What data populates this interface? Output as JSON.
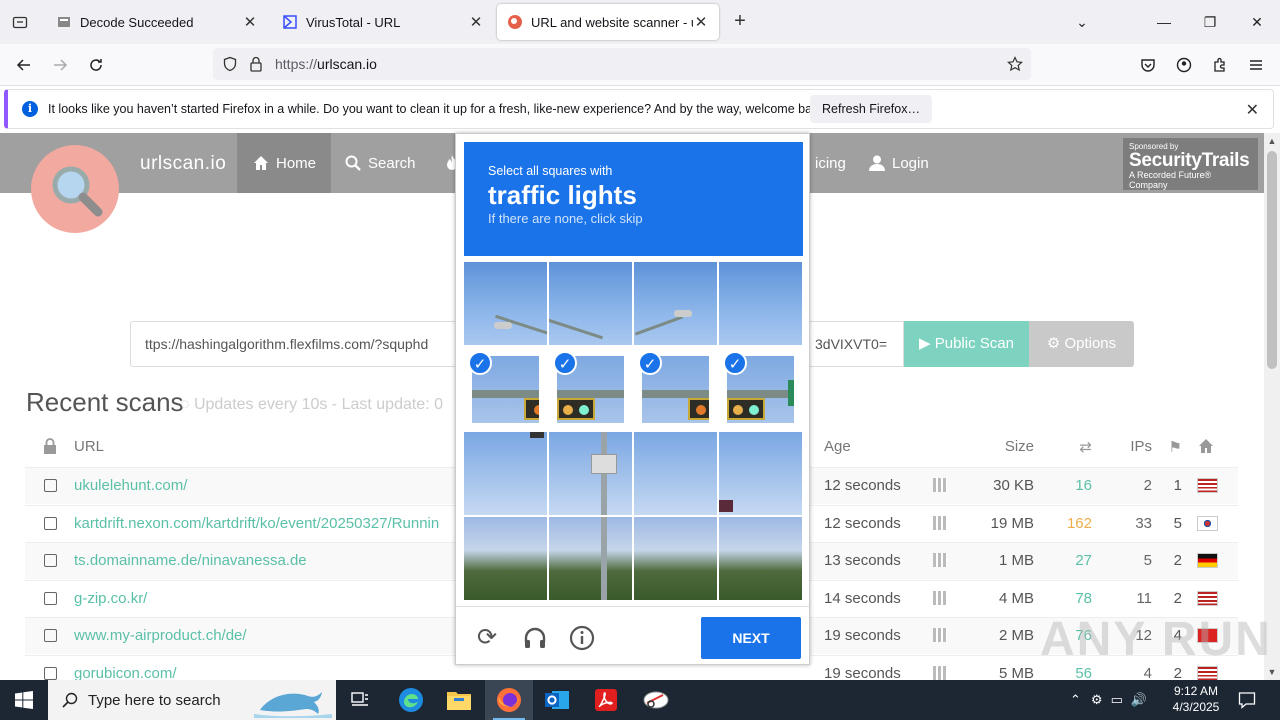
{
  "browser": {
    "tabs": [
      {
        "title": "Decode Succeeded",
        "active": false
      },
      {
        "title": "VirusTotal - URL",
        "active": false
      },
      {
        "title": "URL and website scanner - urlsca",
        "active": true
      }
    ],
    "url_prefix": "https://",
    "url_host": "urlscan.io",
    "notification": {
      "message": "It looks like you haven’t started Firefox in a while. Do you want to clean it up for a fresh, like-new experience? And by the way, welcome back!",
      "button": "Refresh Firefox…"
    }
  },
  "site": {
    "brand": "urlscan.io",
    "nav": [
      {
        "label": "Home",
        "icon": "home-icon"
      },
      {
        "label": "Search",
        "icon": "search-icon"
      },
      {
        "label": "icing",
        "icon": ""
      },
      {
        "label": "Login",
        "icon": "user-icon"
      }
    ],
    "sponsor": {
      "line1": "Sponsored by",
      "line2": "SecurityTrails",
      "line3": "A Recorded Future® Company"
    },
    "search_value": "ttps://hashingalgorithm.flexfilms.com/?squphd",
    "search_tail": "3dVIXVT0=",
    "public_scan": "Public Scan",
    "options": "Options",
    "recent_title": "Recent scans",
    "recent_sub": "Updates every 10s - Last update: 0",
    "columns": {
      "url": "URL",
      "age": "Age",
      "size": "Size",
      "ips": "IPs"
    },
    "rows": [
      {
        "url": "ukulelehunt.com/",
        "age": "12 seconds",
        "size": "30 KB",
        "requests": "16",
        "ips": "2",
        "flags": "1",
        "country": "us"
      },
      {
        "url": "kartdrift.nexon.com/kartdrift/ko/event/20250327/Runnin",
        "age": "12 seconds",
        "size": "19 MB",
        "requests": "162",
        "ips": "33",
        "flags": "5",
        "country": "kr"
      },
      {
        "url": "ts.domainname.de/ninavanessa.de",
        "age": "13 seconds",
        "size": "1 MB",
        "requests": "27",
        "ips": "5",
        "flags": "2",
        "country": "de"
      },
      {
        "url": "g-zip.co.kr/",
        "age": "14 seconds",
        "size": "4 MB",
        "requests": "78",
        "ips": "11",
        "flags": "2",
        "country": "us"
      },
      {
        "url": "www.my-airproduct.ch/de/",
        "age": "19 seconds",
        "size": "2 MB",
        "requests": "76",
        "ips": "12",
        "flags": "4",
        "country": "ch"
      },
      {
        "url": "gorubicon.com/",
        "age": "19 seconds",
        "size": "5 MB",
        "requests": "56",
        "ips": "4",
        "flags": "2",
        "country": "us"
      }
    ]
  },
  "captcha": {
    "line1": "Select all squares with",
    "target": "traffic lights",
    "line3": "If there are none, click skip",
    "next": "NEXT"
  },
  "taskbar": {
    "search_placeholder": "Type here to search",
    "time": "9:12 AM",
    "date": "4/3/2025"
  },
  "watermark": "ANY RUN",
  "colors": {
    "accent": "#1a73e8",
    "teal": "#5bc0a8",
    "header": "#a0a0a0"
  }
}
